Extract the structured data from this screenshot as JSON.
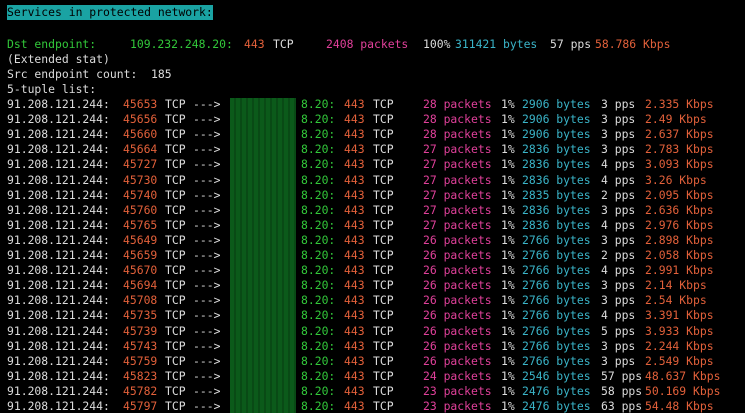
{
  "colors": {
    "background": "#000000",
    "text": "#dcdcdc",
    "banner_bg": "#1aa3a3",
    "green": "#32c83a",
    "orange": "#e2603a",
    "magenta": "#e0409a",
    "cyan": "#3ab4c8",
    "mask": "#0b5a1a"
  },
  "banner": "Services in protected network:",
  "dst": {
    "label": "Dst endpoint:",
    "ip": "109.232.248.20:",
    "port": "443",
    "proto": "TCP",
    "packets": "2408 packets",
    "percent": "100%",
    "bytes": "311421 bytes",
    "pps": "57 pps",
    "kbps": "58.786 Kbps"
  },
  "extended": "(Extended stat)",
  "src_count": "Src endpoint count:  185",
  "tuple_header": "5-tuple list:",
  "rows": [
    {
      "src": "91.208.121.244:",
      "sport": "45653",
      "proto": "TCP",
      "arrow": "--->",
      "dst": "8.20:",
      "dport": "443",
      "dproto": "TCP",
      "packets": "28 packets",
      "pct": "1%",
      "bytes": "2906 bytes",
      "pps": "3 pps",
      "kbps": "2.335 Kbps"
    },
    {
      "src": "91.208.121.244:",
      "sport": "45656",
      "proto": "TCP",
      "arrow": "--->",
      "dst": "8.20:",
      "dport": "443",
      "dproto": "TCP",
      "packets": "28 packets",
      "pct": "1%",
      "bytes": "2906 bytes",
      "pps": "3 pps",
      "kbps": "2.49 Kbps"
    },
    {
      "src": "91.208.121.244:",
      "sport": "45660",
      "proto": "TCP",
      "arrow": "--->",
      "dst": "8.20:",
      "dport": "443",
      "dproto": "TCP",
      "packets": "28 packets",
      "pct": "1%",
      "bytes": "2906 bytes",
      "pps": "3 pps",
      "kbps": "2.637 Kbps"
    },
    {
      "src": "91.208.121.244:",
      "sport": "45664",
      "proto": "TCP",
      "arrow": "--->",
      "dst": "8.20:",
      "dport": "443",
      "dproto": "TCP",
      "packets": "27 packets",
      "pct": "1%",
      "bytes": "2836 bytes",
      "pps": "3 pps",
      "kbps": "2.783 Kbps"
    },
    {
      "src": "91.208.121.244:",
      "sport": "45727",
      "proto": "TCP",
      "arrow": "--->",
      "dst": "8.20:",
      "dport": "443",
      "dproto": "TCP",
      "packets": "27 packets",
      "pct": "1%",
      "bytes": "2836 bytes",
      "pps": "4 pps",
      "kbps": "3.093 Kbps"
    },
    {
      "src": "91.208.121.244:",
      "sport": "45730",
      "proto": "TCP",
      "arrow": "--->",
      "dst": "8.20:",
      "dport": "443",
      "dproto": "TCP",
      "packets": "27 packets",
      "pct": "1%",
      "bytes": "2836 bytes",
      "pps": "4 pps",
      "kbps": "3.26 Kbps"
    },
    {
      "src": "91.208.121.244:",
      "sport": "45740",
      "proto": "TCP",
      "arrow": "--->",
      "dst": "8.20:",
      "dport": "443",
      "dproto": "TCP",
      "packets": "27 packets",
      "pct": "1%",
      "bytes": "2835 bytes",
      "pps": "2 pps",
      "kbps": "2.095 Kbps"
    },
    {
      "src": "91.208.121.244:",
      "sport": "45760",
      "proto": "TCP",
      "arrow": "--->",
      "dst": "8.20:",
      "dport": "443",
      "dproto": "TCP",
      "packets": "27 packets",
      "pct": "1%",
      "bytes": "2836 bytes",
      "pps": "3 pps",
      "kbps": "2.636 Kbps"
    },
    {
      "src": "91.208.121.244:",
      "sport": "45765",
      "proto": "TCP",
      "arrow": "--->",
      "dst": "8.20:",
      "dport": "443",
      "dproto": "TCP",
      "packets": "27 packets",
      "pct": "1%",
      "bytes": "2836 bytes",
      "pps": "4 pps",
      "kbps": "2.976 Kbps"
    },
    {
      "src": "91.208.121.244:",
      "sport": "45649",
      "proto": "TCP",
      "arrow": "--->",
      "dst": "8.20:",
      "dport": "443",
      "dproto": "TCP",
      "packets": "26 packets",
      "pct": "1%",
      "bytes": "2766 bytes",
      "pps": "3 pps",
      "kbps": "2.898 Kbps"
    },
    {
      "src": "91.208.121.244:",
      "sport": "45659",
      "proto": "TCP",
      "arrow": "--->",
      "dst": "8.20:",
      "dport": "443",
      "dproto": "TCP",
      "packets": "26 packets",
      "pct": "1%",
      "bytes": "2766 bytes",
      "pps": "2 pps",
      "kbps": "2.058 Kbps"
    },
    {
      "src": "91.208.121.244:",
      "sport": "45670",
      "proto": "TCP",
      "arrow": "--->",
      "dst": "8.20:",
      "dport": "443",
      "dproto": "TCP",
      "packets": "26 packets",
      "pct": "1%",
      "bytes": "2766 bytes",
      "pps": "4 pps",
      "kbps": "2.991 Kbps"
    },
    {
      "src": "91.208.121.244:",
      "sport": "45694",
      "proto": "TCP",
      "arrow": "--->",
      "dst": "8.20:",
      "dport": "443",
      "dproto": "TCP",
      "packets": "26 packets",
      "pct": "1%",
      "bytes": "2766 bytes",
      "pps": "3 pps",
      "kbps": "2.14 Kbps"
    },
    {
      "src": "91.208.121.244:",
      "sport": "45708",
      "proto": "TCP",
      "arrow": "--->",
      "dst": "8.20:",
      "dport": "443",
      "dproto": "TCP",
      "packets": "26 packets",
      "pct": "1%",
      "bytes": "2766 bytes",
      "pps": "3 pps",
      "kbps": "2.54 Kbps"
    },
    {
      "src": "91.208.121.244:",
      "sport": "45735",
      "proto": "TCP",
      "arrow": "--->",
      "dst": "8.20:",
      "dport": "443",
      "dproto": "TCP",
      "packets": "26 packets",
      "pct": "1%",
      "bytes": "2766 bytes",
      "pps": "4 pps",
      "kbps": "3.391 Kbps"
    },
    {
      "src": "91.208.121.244:",
      "sport": "45739",
      "proto": "TCP",
      "arrow": "--->",
      "dst": "8.20:",
      "dport": "443",
      "dproto": "TCP",
      "packets": "26 packets",
      "pct": "1%",
      "bytes": "2766 bytes",
      "pps": "5 pps",
      "kbps": "3.933 Kbps"
    },
    {
      "src": "91.208.121.244:",
      "sport": "45743",
      "proto": "TCP",
      "arrow": "--->",
      "dst": "8.20:",
      "dport": "443",
      "dproto": "TCP",
      "packets": "26 packets",
      "pct": "1%",
      "bytes": "2766 bytes",
      "pps": "3 pps",
      "kbps": "2.244 Kbps"
    },
    {
      "src": "91.208.121.244:",
      "sport": "45759",
      "proto": "TCP",
      "arrow": "--->",
      "dst": "8.20:",
      "dport": "443",
      "dproto": "TCP",
      "packets": "26 packets",
      "pct": "1%",
      "bytes": "2766 bytes",
      "pps": "3 pps",
      "kbps": "2.549 Kbps"
    },
    {
      "src": "91.208.121.244:",
      "sport": "45823",
      "proto": "TCP",
      "arrow": "--->",
      "dst": "8.20:",
      "dport": "443",
      "dproto": "TCP",
      "packets": "24 packets",
      "pct": "1%",
      "bytes": "2546 bytes",
      "pps": "57 pps",
      "kbps": "48.637 Kbps"
    },
    {
      "src": "91.208.121.244:",
      "sport": "45782",
      "proto": "TCP",
      "arrow": "--->",
      "dst": "8.20:",
      "dport": "443",
      "dproto": "TCP",
      "packets": "23 packets",
      "pct": "1%",
      "bytes": "2476 bytes",
      "pps": "58 pps",
      "kbps": "50.169 Kbps"
    },
    {
      "src": "91.208.121.244:",
      "sport": "45797",
      "proto": "TCP",
      "arrow": "--->",
      "dst": "8.20:",
      "dport": "443",
      "dproto": "TCP",
      "packets": "23 packets",
      "pct": "1%",
      "bytes": "2476 bytes",
      "pps": "63 pps",
      "kbps": "54.48 Kbps"
    }
  ]
}
